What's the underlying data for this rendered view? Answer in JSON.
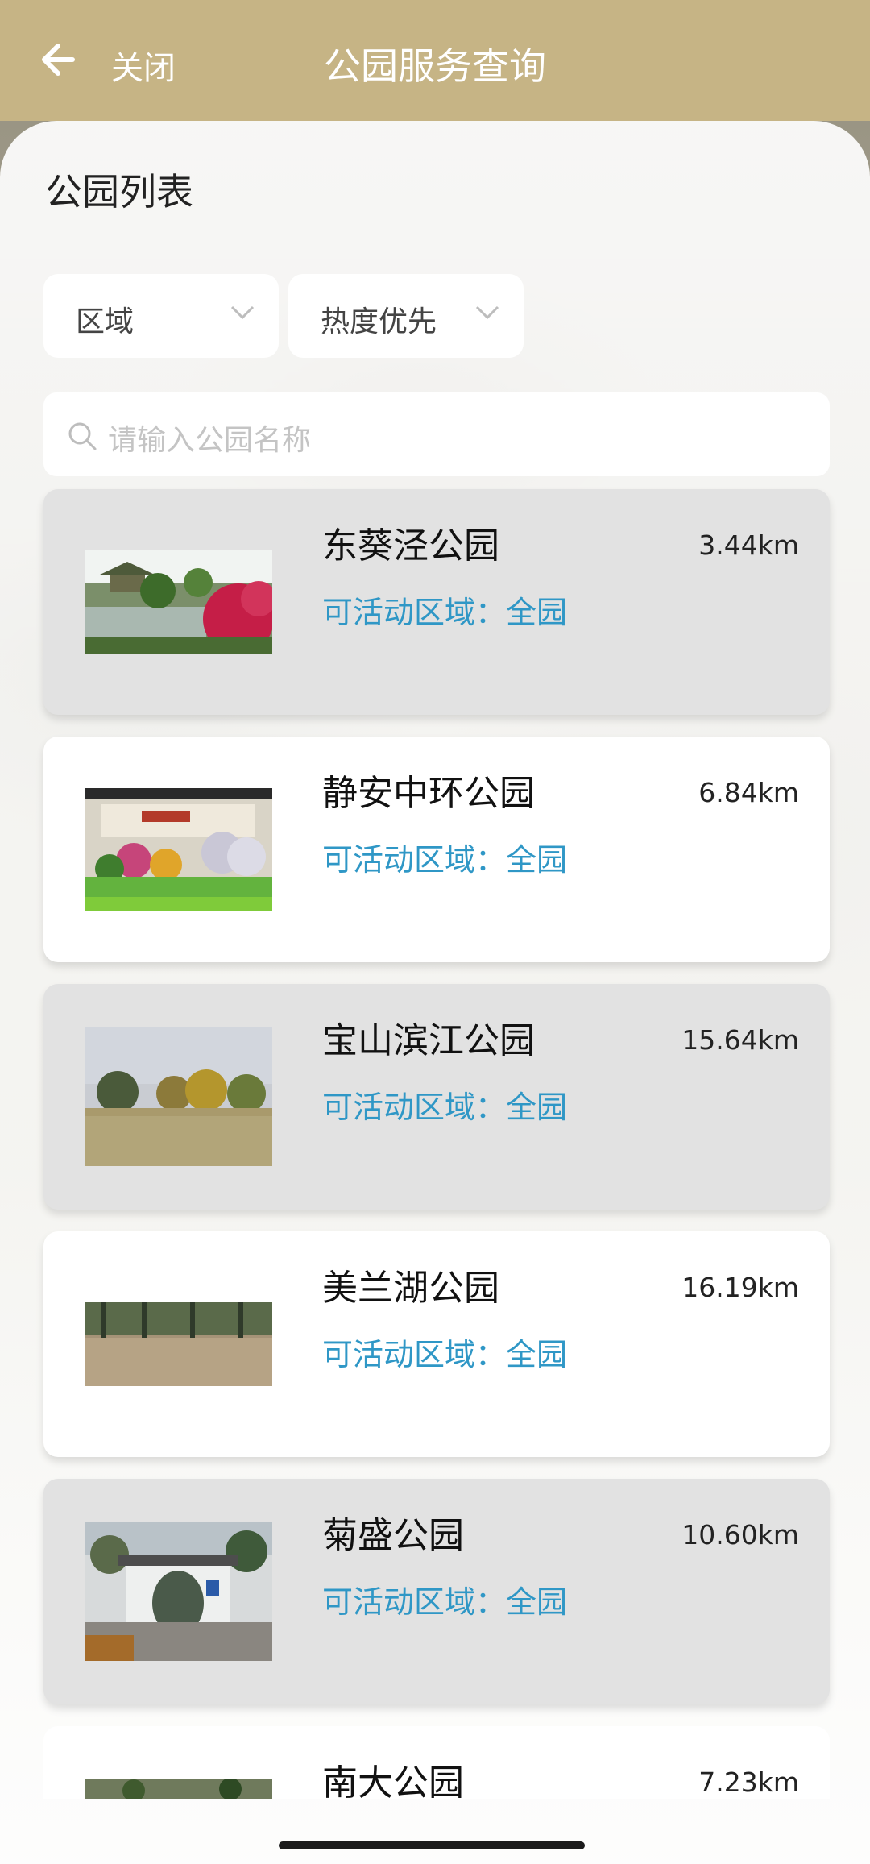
{
  "header": {
    "close_label": "关闭",
    "title": "公园服务查询",
    "background": "#c6b485"
  },
  "section_title": "公园列表",
  "filters": [
    {
      "label": "区域"
    },
    {
      "label": "热度优先"
    }
  ],
  "search": {
    "placeholder": "请输入公园名称"
  },
  "accent_color": "#2f97c6",
  "parks": [
    {
      "name": "东葵泾公园",
      "area": "可活动区域：全园",
      "distance": "3.44km",
      "style": "gray",
      "thumb": "lake-garden"
    },
    {
      "name": "静安中环公园",
      "area": "可活动区域：全园",
      "distance": "6.84km",
      "style": "white",
      "thumb": "flower-beds"
    },
    {
      "name": "宝山滨江公园",
      "area": "可活动区域：全园",
      "distance": "15.64km",
      "style": "gray",
      "thumb": "lawn-trees"
    },
    {
      "name": "美兰湖公园",
      "area": "可活动区域：全园",
      "distance": "16.19km",
      "style": "white",
      "thumb": "grass-field"
    },
    {
      "name": "菊盛公园",
      "area": "可活动区域：全园",
      "distance": "10.60km",
      "style": "gray",
      "thumb": "park-gate"
    },
    {
      "name": "南大公园",
      "area": "",
      "distance": "7.23km",
      "style": "white",
      "thumb": "trees"
    }
  ]
}
